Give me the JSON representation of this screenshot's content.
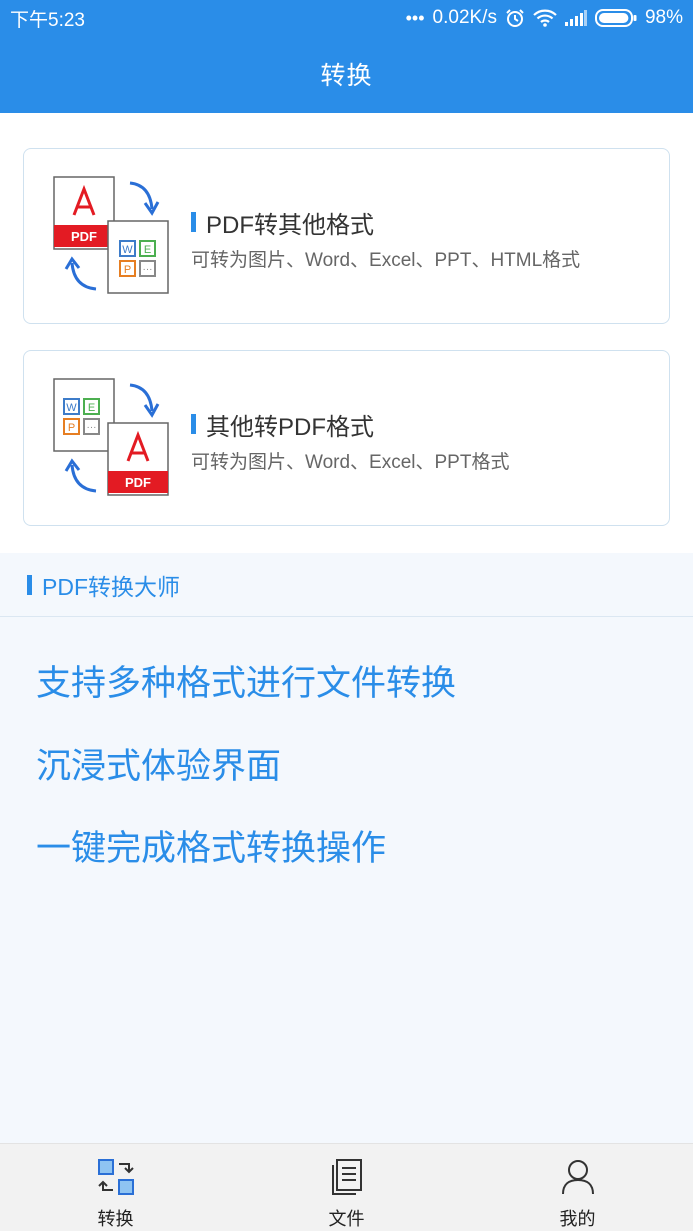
{
  "status_bar": {
    "time": "下午5:23",
    "dots": "•••",
    "network_speed": "0.02K/s",
    "battery": "98%",
    "battery_level": 0.98
  },
  "header": {
    "title": "转换"
  },
  "cards": [
    {
      "title": "PDF转其他格式",
      "subtitle": "可转为图片、Word、Excel、PPT、HTML格式",
      "illus_label": "PDF"
    },
    {
      "title": "其他转PDF格式",
      "subtitle": "可转为图片、Word、Excel、PPT格式",
      "illus_label": "PDF"
    }
  ],
  "promo": {
    "heading": "PDF转换大师",
    "features": [
      "支持多种格式进行文件转换",
      "沉浸式体验界面",
      "一键完成格式转换操作"
    ]
  },
  "tabbar": {
    "tabs": [
      {
        "label": "转换",
        "icon": "convert-icon"
      },
      {
        "label": "文件",
        "icon": "file-icon"
      },
      {
        "label": "我的",
        "icon": "user-icon"
      }
    ]
  },
  "colors": {
    "accent": "#2a8de8",
    "pdf_red": "#e31b23"
  }
}
